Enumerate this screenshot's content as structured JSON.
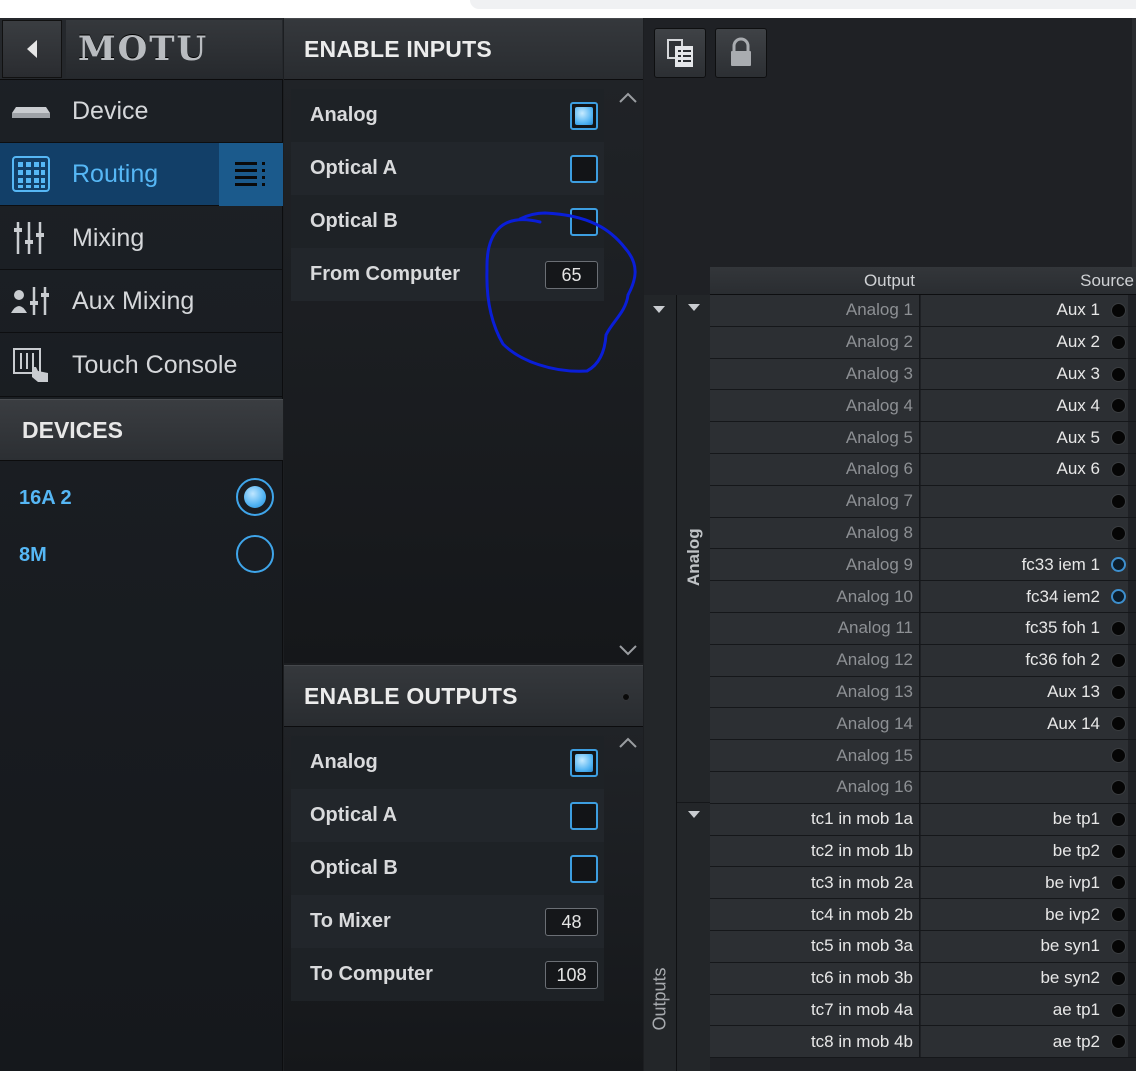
{
  "app": {
    "logo_text": "MOTU"
  },
  "sidebar": {
    "items": [
      {
        "label": "Device",
        "icon": "device-icon"
      },
      {
        "label": "Routing",
        "icon": "routing-grid-icon",
        "active": true
      },
      {
        "label": "Mixing",
        "icon": "mixer-faders-icon"
      },
      {
        "label": "Aux Mixing",
        "icon": "aux-mixing-icon"
      },
      {
        "label": "Touch Console",
        "icon": "touch-console-icon"
      }
    ],
    "devices_header": "DEVICES",
    "devices": [
      {
        "name": "16A 2",
        "selected": true
      },
      {
        "name": "8M",
        "selected": false
      }
    ]
  },
  "inputs": {
    "header": "ENABLE INPUTS",
    "options": [
      {
        "label": "Analog",
        "type": "checkbox",
        "checked": true
      },
      {
        "label": "Optical A",
        "type": "checkbox",
        "checked": false
      },
      {
        "label": "Optical B",
        "type": "checkbox",
        "checked": false
      },
      {
        "label": "From Computer",
        "type": "number",
        "value": "65"
      }
    ]
  },
  "outputs": {
    "header": "ENABLE OUTPUTS",
    "options": [
      {
        "label": "Analog",
        "type": "checkbox",
        "checked": true
      },
      {
        "label": "Optical A",
        "type": "checkbox",
        "checked": false
      },
      {
        "label": "Optical B",
        "type": "checkbox",
        "checked": false
      },
      {
        "label": "To Mixer",
        "type": "number",
        "value": "48"
      },
      {
        "label": "To Computer",
        "type": "number",
        "value": "108"
      }
    ]
  },
  "routing": {
    "col_output": "Output",
    "col_source": "Source",
    "group_outer": "Outputs",
    "group_analog": "Analog",
    "rows": [
      {
        "output": "Analog 1",
        "source": "Aux 1",
        "group": "analog",
        "dot": "black"
      },
      {
        "output": "Analog 2",
        "source": "Aux 2",
        "group": "analog",
        "dot": "black"
      },
      {
        "output": "Analog 3",
        "source": "Aux 3",
        "group": "analog",
        "dot": "black"
      },
      {
        "output": "Analog 4",
        "source": "Aux 4",
        "group": "analog",
        "dot": "black"
      },
      {
        "output": "Analog 5",
        "source": "Aux 5",
        "group": "analog",
        "dot": "black"
      },
      {
        "output": "Analog 6",
        "source": "Aux 6",
        "group": "analog",
        "dot": "black"
      },
      {
        "output": "Analog 7",
        "source": "",
        "group": "analog",
        "dot": "black"
      },
      {
        "output": "Analog 8",
        "source": "",
        "group": "analog",
        "dot": "black"
      },
      {
        "output": "Analog 9",
        "source": "fc33 iem 1",
        "group": "analog",
        "dot": "blue"
      },
      {
        "output": "Analog 10",
        "source": "fc34 iem2",
        "group": "analog",
        "dot": "blue"
      },
      {
        "output": "Analog 11",
        "source": "fc35 foh 1",
        "group": "analog",
        "dot": "black"
      },
      {
        "output": "Analog 12",
        "source": "fc36 foh 2",
        "group": "analog",
        "dot": "black"
      },
      {
        "output": "Analog 13",
        "source": "Aux 13",
        "group": "analog",
        "dot": "black"
      },
      {
        "output": "Analog 14",
        "source": "Aux 14",
        "group": "analog",
        "dot": "black"
      },
      {
        "output": "Analog 15",
        "source": "",
        "group": "analog",
        "dot": "black"
      },
      {
        "output": "Analog 16",
        "source": "",
        "group": "analog",
        "dot": "black"
      },
      {
        "output": "tc1 in mob 1a",
        "source": "be tp1",
        "group": "tc",
        "dot": "black"
      },
      {
        "output": "tc2 in mob 1b",
        "source": "be tp2",
        "group": "tc",
        "dot": "black"
      },
      {
        "output": "tc3 in mob 2a",
        "source": "be ivp1",
        "group": "tc",
        "dot": "black"
      },
      {
        "output": "tc4 in mob 2b",
        "source": "be ivp2",
        "group": "tc",
        "dot": "black"
      },
      {
        "output": "tc5 in mob 3a",
        "source": "be syn1",
        "group": "tc",
        "dot": "black"
      },
      {
        "output": "tc6 in mob 3b",
        "source": "be syn2",
        "group": "tc",
        "dot": "black"
      },
      {
        "output": "tc7 in mob 4a",
        "source": "ae tp1",
        "group": "tc",
        "dot": "black"
      },
      {
        "output": "tc8 in mob 4b",
        "source": "ae tp2",
        "group": "tc",
        "dot": "black"
      }
    ]
  },
  "colors": {
    "accent": "#56b7f5",
    "active_nav_bg": "#123f68",
    "annotation_stroke": "#0a1ed8"
  }
}
